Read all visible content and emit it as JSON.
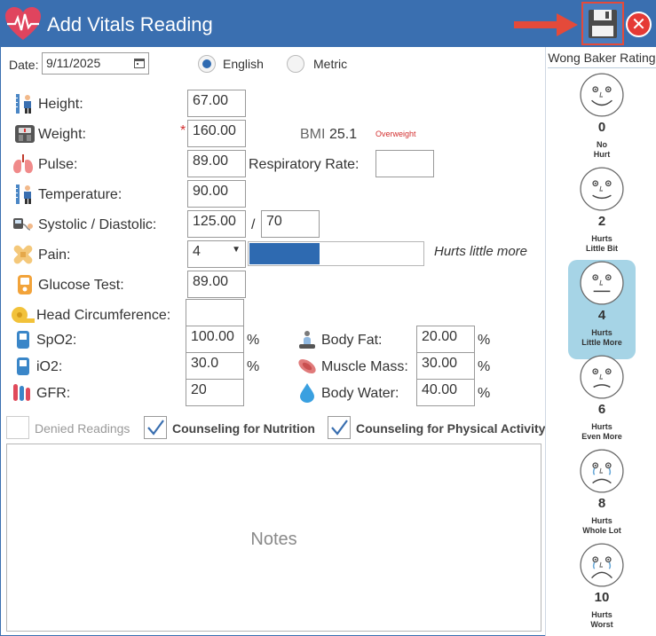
{
  "window": {
    "title": "Add Vitals Reading"
  },
  "toolbar": {
    "save": "floppy-disk-icon",
    "close_glyph": "✕"
  },
  "date": {
    "label": "Date:",
    "value": "9/11/2025"
  },
  "units": {
    "english": "English",
    "metric": "Metric",
    "selected": "English"
  },
  "vitals": {
    "height": {
      "label": "Height:",
      "value": "67.00"
    },
    "weight": {
      "label": "Weight:",
      "value": "160.00",
      "required_mark": "*"
    },
    "bmi": {
      "label": "BMI",
      "value": "25.1",
      "status": "Overweight",
      "status_color": "#d32f2f"
    },
    "pulse": {
      "label": "Pulse:",
      "value": "89.00"
    },
    "respiratory": {
      "label": "Respiratory Rate:",
      "value": ""
    },
    "temperature": {
      "label": "Temperature:",
      "value": "90.00"
    },
    "bp": {
      "label": "Systolic / Diastolic:",
      "systolic": "125.00",
      "separator": "/",
      "diastolic": "70"
    },
    "pain": {
      "label": "Pain:",
      "value": "4",
      "level_fraction": 0.4,
      "bar_color": "#2e6ab1",
      "description": "Hurts little more"
    },
    "glucose": {
      "label": "Glucose Test:",
      "value": "89.00"
    },
    "head": {
      "label": "Head Circumference:",
      "value": ""
    },
    "spo2": {
      "label": "SpO2:",
      "value": "100.00",
      "unit": "%"
    },
    "io2": {
      "label": "iO2:",
      "value": "30.0",
      "unit": "%"
    },
    "gfr": {
      "label": "GFR:",
      "value": "20"
    },
    "body_fat": {
      "label": "Body Fat:",
      "value": "20.00",
      "unit": "%"
    },
    "muscle_mass": {
      "label": "Muscle Mass:",
      "value": "30.00",
      "unit": "%"
    },
    "body_water": {
      "label": "Body Water:",
      "value": "40.00",
      "unit": "%"
    }
  },
  "checks": {
    "denied": {
      "label": "Denied Readings",
      "checked": false,
      "enabled": false
    },
    "nutrition": {
      "label": "Counseling for Nutrition",
      "checked": true
    },
    "physical": {
      "label": "Counseling for Physical Activity",
      "checked": true
    }
  },
  "notes": {
    "placeholder": "Notes"
  },
  "wong_baker": {
    "title": "Wong Baker Rating",
    "selected": "4",
    "selected_color": "#a6d4e6",
    "faces": [
      {
        "value": "0",
        "label": "No\nHurt"
      },
      {
        "value": "2",
        "label": "Hurts\nLittle Bit"
      },
      {
        "value": "4",
        "label": "Hurts\nLittle More"
      },
      {
        "value": "6",
        "label": "Hurts\nEven More"
      },
      {
        "value": "8",
        "label": "Hurts\nWhole Lot"
      },
      {
        "value": "10",
        "label": "Hurts\nWorst"
      }
    ]
  },
  "colors": {
    "titlebar": "#3a6fb0",
    "accent": "#2e6ab1",
    "close": "#e53935",
    "highlight": "#e44a3a"
  }
}
